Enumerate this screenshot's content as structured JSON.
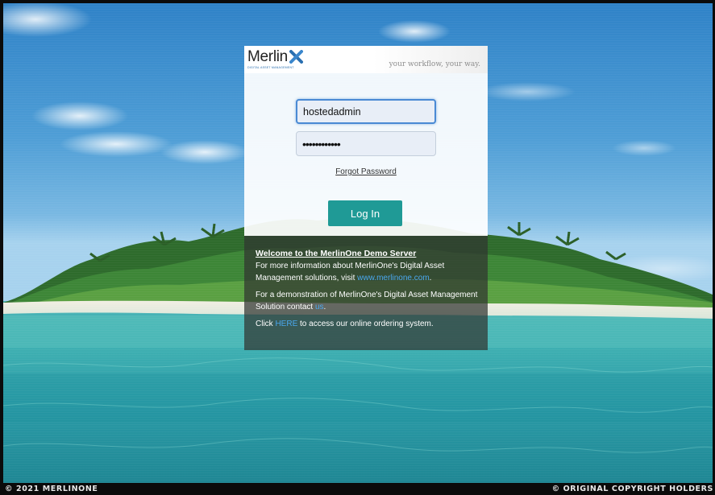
{
  "brand": {
    "logo_text": "Merlin",
    "logo_subtext": "DIGITAL ASSET MANAGEMENT",
    "tagline": "your workflow, your way."
  },
  "login": {
    "username_value": "hostedadmin",
    "password_value": "••••••••••••",
    "forgot_label": "Forgot Password",
    "login_button_label": "Log In"
  },
  "info": {
    "title": "Welcome to the MerlinOne Demo Server",
    "p1_text": "For more information about MerlinOne's Digital Asset Management solutions, visit ",
    "p1_link": "www.merlinone.com",
    "p1_end": ".",
    "p2_text": "For a demonstration of MerlinOne's Digital Asset Management Solution contact ",
    "p2_link": "us",
    "p2_end": ".",
    "p3_start": "Click ",
    "p3_link": "HERE",
    "p3_end": " to access our online ordering system."
  },
  "footer": {
    "left": "© 2021 MERLINONE",
    "right": "© ORIGINAL COPYRIGHT HOLDERS"
  },
  "colors": {
    "accent_button": "#1f9a96",
    "link": "#4aa8ef",
    "logo_x": "#2a6fb0"
  },
  "icons": {
    "logo_mark": "merlin-x-logo-icon"
  }
}
